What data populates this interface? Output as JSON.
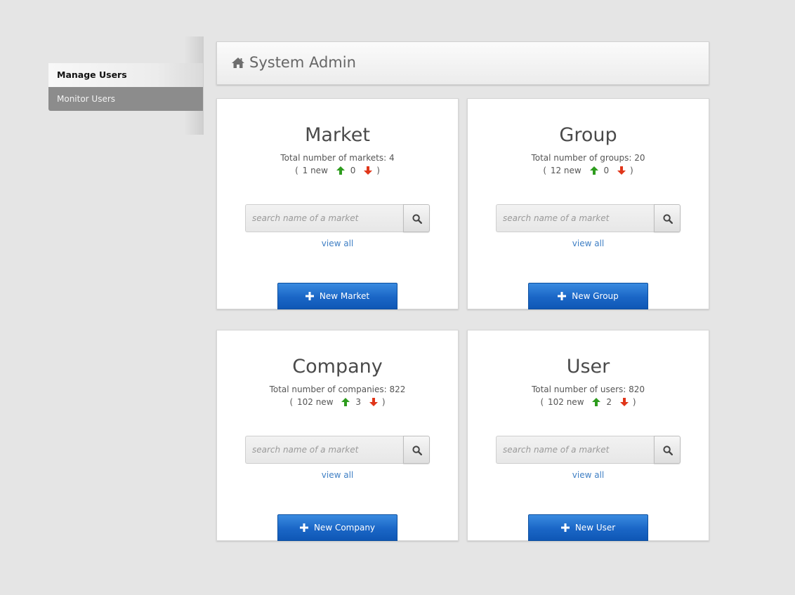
{
  "sidebar": {
    "items": [
      {
        "label": "Manage Users",
        "active": true
      },
      {
        "label": "Monitor Users",
        "active": false
      }
    ]
  },
  "header": {
    "icon": "home-icon",
    "title": "System Admin"
  },
  "colors": {
    "accent": "#1a66c6",
    "up_arrow": "#2e9c1e",
    "down_arrow": "#e0361a",
    "link": "#3f7fc4"
  },
  "cards": [
    {
      "title": "Market",
      "total": "Total number of markets: 4",
      "new_label": "1 new",
      "up": "0",
      "down": "",
      "search_placeholder": "search name of a market",
      "view_all": "view all",
      "button": "New Market"
    },
    {
      "title": "Group",
      "total": "Total number of groups: 20",
      "new_label": "12 new",
      "up": "0",
      "down": "",
      "search_placeholder": "search name of a market",
      "view_all": "view all",
      "button": "New Group"
    },
    {
      "title": "Company",
      "total": "Total number of companies: 822",
      "new_label": "102 new",
      "up": "3",
      "down": "",
      "search_placeholder": "search name of a market",
      "view_all": "view all",
      "button": "New Company"
    },
    {
      "title": "User",
      "total": "Total number of users: 820",
      "new_label": "102 new",
      "up": "2",
      "down": "",
      "search_placeholder": "search name of a market",
      "view_all": "view all",
      "button": "New User"
    }
  ]
}
